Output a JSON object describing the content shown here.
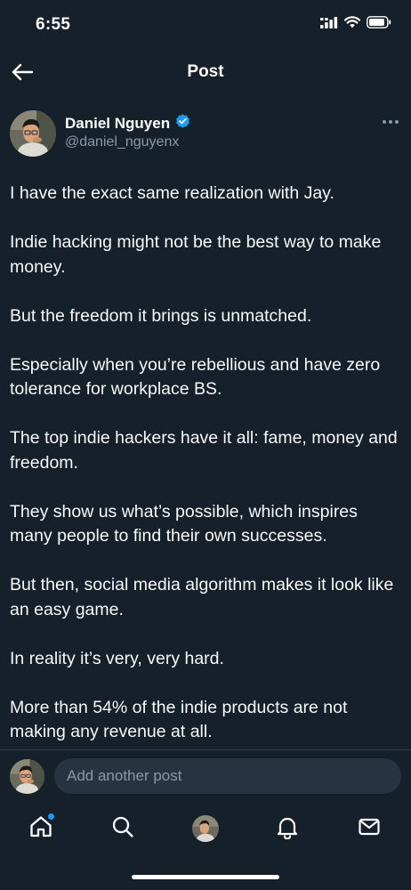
{
  "status_bar": {
    "time": "6:55"
  },
  "header": {
    "title": "Post",
    "back_icon": "arrow-left-icon"
  },
  "author": {
    "name": "Daniel Nguyen",
    "handle": "@daniel_nguyenx",
    "verified": true
  },
  "post": {
    "paragraphs": [
      "I have the exact same realization with Jay.",
      "Indie hacking might not be the best way to make money.",
      "But the freedom it brings is unmatched.",
      "Especially when you’re rebellious and have zero tolerance for workplace BS.",
      "The top indie hackers have it all: fame, money and freedom.",
      "They show us what’s possible, which inspires many people to find their own successes.",
      "But then, social media algorithm makes it look like an easy game.",
      "In reality it’s very, very hard.",
      "More than 54% of the indie products are not making any revenue at all."
    ]
  },
  "reply": {
    "placeholder": "Add another post"
  },
  "tab_bar": {
    "items": [
      "home-icon",
      "search-icon",
      "communities-avatar",
      "bell-icon",
      "mail-icon"
    ]
  },
  "colors": {
    "background": "#15202b",
    "accent": "#1d9bf0",
    "secondary_text": "#8b98a5"
  }
}
